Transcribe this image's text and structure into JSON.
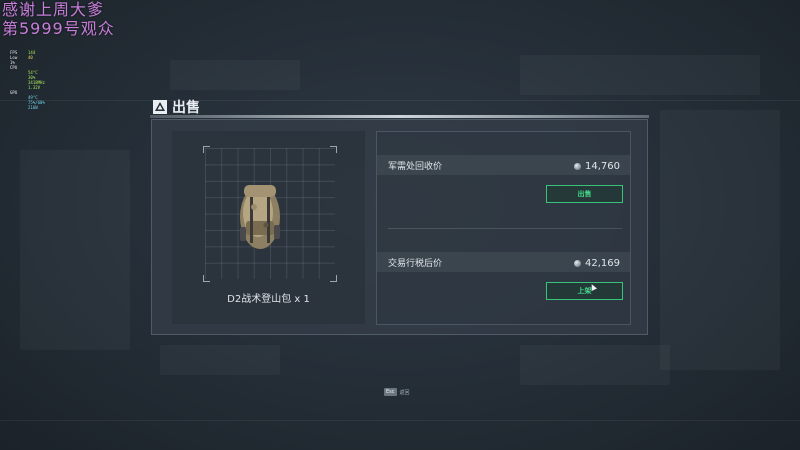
{
  "overlay": {
    "line1": "感谢上周大爹",
    "line2": "第5999号观众",
    "perf": [
      {
        "k": "FPS",
        "v": "144"
      },
      {
        "k": "Low 1%",
        "v": "40"
      },
      {
        "k": "CPU",
        "v": ""
      },
      {
        "k": "",
        "v": "54°C"
      },
      {
        "k": "",
        "v": "30%"
      },
      {
        "k": "",
        "v": "3418MHz"
      },
      {
        "k": "",
        "v": "1.32V"
      },
      {
        "k": "GPU",
        "v": ""
      },
      {
        "k": "",
        "v": "49°C"
      },
      {
        "k": "",
        "v": "75%/60%"
      },
      {
        "k": "",
        "v": "216W"
      }
    ]
  },
  "dialog": {
    "title": "出售",
    "item": {
      "name": "D2战术登山包 x 1",
      "icon": "backpack-image"
    },
    "recycle": {
      "label": "军需处回收价",
      "value": "14,760",
      "button": "出售"
    },
    "trade": {
      "label": "交易行税后价",
      "value": "42,169",
      "button": "上架"
    }
  },
  "footer": {
    "esc_key": "Esc",
    "esc_label": "返回"
  },
  "colors": {
    "accent_green": "#39c27a",
    "overlay_text": "#c77ed8"
  }
}
